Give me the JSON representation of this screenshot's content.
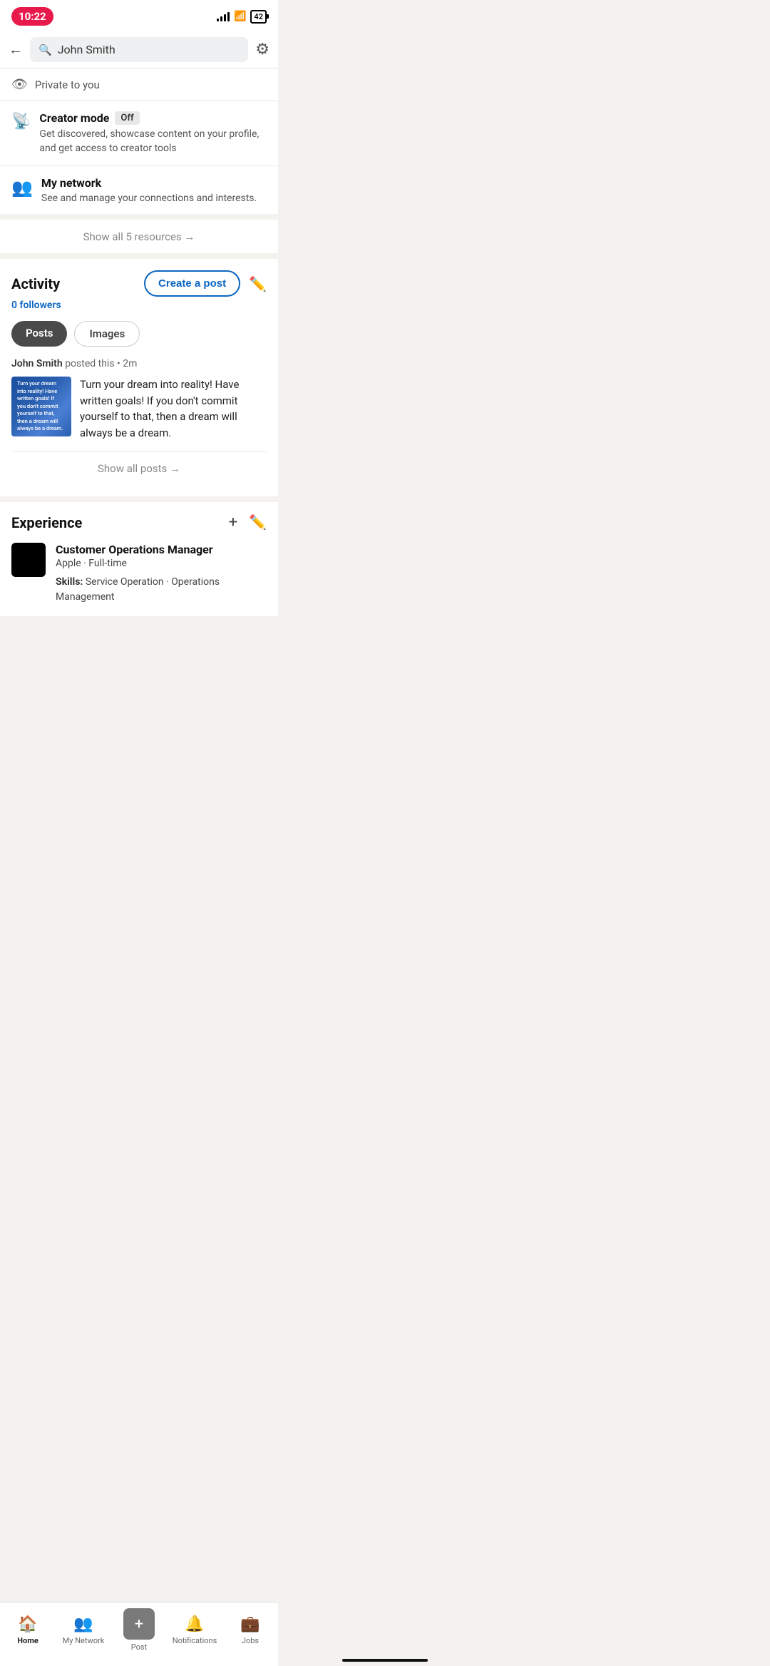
{
  "statusBar": {
    "time": "10:22",
    "battery": "42"
  },
  "header": {
    "searchValue": "John Smith",
    "backLabel": "←",
    "settingsLabel": "⚙"
  },
  "privateRow": {
    "label": "Private to you"
  },
  "creatorMode": {
    "title": "Creator mode",
    "badge": "Off",
    "description": "Get discovered, showcase content on your profile, and get access to creator tools"
  },
  "myNetwork": {
    "title": "My network",
    "description": "See and manage your connections and interests."
  },
  "showResources": {
    "label": "Show all 5 resources →"
  },
  "activity": {
    "title": "Activity",
    "followersLabel": "0 followers",
    "createPostLabel": "Create a post",
    "tabs": [
      {
        "label": "Posts",
        "active": true
      },
      {
        "label": "Images",
        "active": false
      }
    ],
    "post": {
      "author": "John Smith",
      "action": "posted this",
      "time": "2m",
      "text": "Turn your dream into reality! Have written goals! If you don't commit yourself to that, then a dream will always be a dream.",
      "thumbLines": [
        "Turn your dream",
        "into reality! Have",
        "written goals! If",
        "you don't commit",
        "yourself to that,",
        "then a dream will",
        "always be a dream."
      ]
    },
    "showAllLabel": "Show all posts →"
  },
  "experience": {
    "title": "Experience",
    "items": [
      {
        "jobTitle": "Customer Operations Manager",
        "company": "Apple · Full-time",
        "skills": "Skills: Service Operation · Operations Management"
      }
    ]
  },
  "bottomNav": {
    "items": [
      {
        "label": "Home",
        "active": true,
        "icon": "🏠"
      },
      {
        "label": "My Network",
        "active": false,
        "icon": "👥"
      },
      {
        "label": "Post",
        "active": false,
        "icon": "+"
      },
      {
        "label": "Notifications",
        "active": false,
        "icon": "🔔"
      },
      {
        "label": "Jobs",
        "active": false,
        "icon": "💼"
      }
    ]
  }
}
